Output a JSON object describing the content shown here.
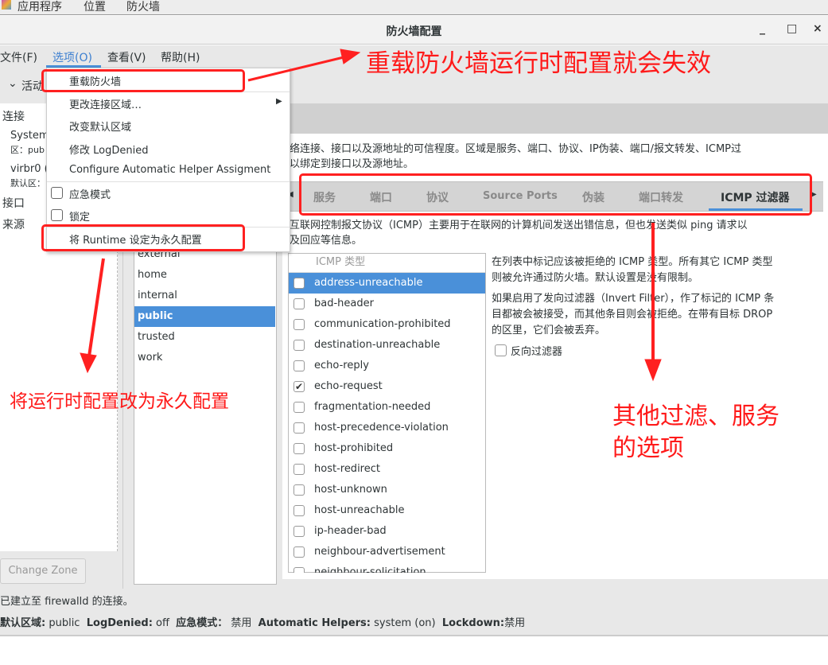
{
  "topbar": {
    "items": [
      "应用程序",
      "位置",
      "防火墙"
    ]
  },
  "window": {
    "title": "防火墙配置",
    "minimize": "_",
    "maximize": "□",
    "close": "×"
  },
  "menubar": [
    "文件(F)",
    "选项(O)",
    "查看(V)",
    "帮助(H)"
  ],
  "options_menu": {
    "reload": "重载防火墙",
    "change_zone": "更改连接区域…",
    "change_default": "改变默认区域",
    "log_denied": "修改 LogDenied",
    "helper": "Configure Automatic Helper Assigment",
    "panic": "应急模式",
    "lockdown": "锁定",
    "runtime_to_perm": "将 Runtime 设定为永久配置"
  },
  "left": {
    "header": "活动",
    "connections": "连接",
    "conn1": "System",
    "conn1_zone": "区：pub",
    "conn2": "virbr0 (",
    "conn2_zone": "默认区：",
    "interfaces": "接口",
    "sources": "来源",
    "change_zone": "Change Zone"
  },
  "main": {
    "desc1": "络连接、接口以及源地址的可信程度。区域是服务、端口、协议、IP伪装、端口/报文转发、ICMP过",
    "desc2": "以绑定到接口以及源地址。",
    "tabs": [
      "服务",
      "端口",
      "协议",
      "Source Ports",
      "伪装",
      "端口转发",
      "ICMP 过滤器"
    ],
    "active_tab": "ICMP 过滤器",
    "icmp_intro1": "互联网控制报文协议（ICMP）主要用于在联网的计算机间发送出错信息，但也发送类似 ping 请求以",
    "icmp_intro2": "及回应等信息。",
    "zones": [
      "external",
      "home",
      "internal",
      "public",
      "trusted",
      "work"
    ],
    "selected_zone": "public",
    "icmp_header": "ICMP 类型",
    "icmp_types": [
      {
        "name": "address-unreachable",
        "checked": false
      },
      {
        "name": "bad-header",
        "checked": false
      },
      {
        "name": "communication-prohibited",
        "checked": false
      },
      {
        "name": "destination-unreachable",
        "checked": false
      },
      {
        "name": "echo-reply",
        "checked": false
      },
      {
        "name": "echo-request",
        "checked": true
      },
      {
        "name": "fragmentation-needed",
        "checked": false
      },
      {
        "name": "host-precedence-violation",
        "checked": false
      },
      {
        "name": "host-prohibited",
        "checked": false
      },
      {
        "name": "host-redirect",
        "checked": false
      },
      {
        "name": "host-unknown",
        "checked": false
      },
      {
        "name": "host-unreachable",
        "checked": false
      },
      {
        "name": "ip-header-bad",
        "checked": false
      },
      {
        "name": "neighbour-advertisement",
        "checked": false
      },
      {
        "name": "neighbour-solicitation",
        "checked": false
      }
    ],
    "help1": "在列表中标记应该被拒绝的 ICMP 类型。所有其它 ICMP 类型",
    "help2": "则被允许通过防火墙。默认设置是没有限制。",
    "help3": "如果启用了发向过滤器（Invert Filter），作了标记的 ICMP 条",
    "help4": "目都被会被接受，而其他条目则会被拒绝。在带有目标 DROP",
    "help5": "的区里，它们会被丢弃。",
    "invert": "反向过滤器"
  },
  "status": {
    "line1": "已建立至 firewalld 的连接。",
    "default_zone_label": "默认区域:",
    "default_zone": "public",
    "logdenied_label": "LogDenied:",
    "logdenied": "off",
    "panic_label": "应急模式：",
    "panic": "禁用",
    "helpers_label": "Automatic Helpers:",
    "helpers": "system (on)",
    "lockdown_label": "Lockdown:",
    "lockdown": "禁用"
  },
  "annotations": {
    "a1": "重载防火墙运行时配置就会失效",
    "a2": "将运行时配置改为永久配置",
    "a3_1": "其他过滤、服务",
    "a3_2": "的选项",
    "color": "#ff1a1a"
  },
  "colors": {
    "accent": "#4a90d9"
  }
}
